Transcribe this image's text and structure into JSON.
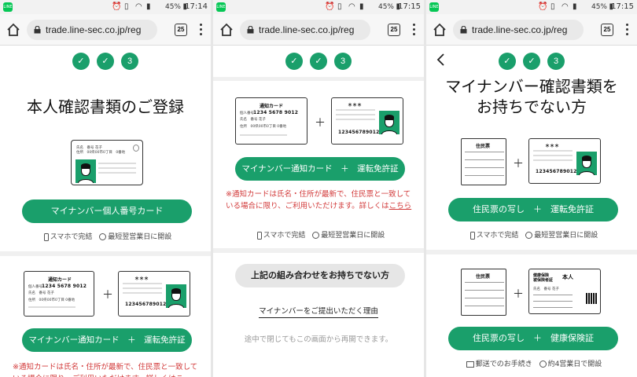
{
  "status": {
    "battery": "45%",
    "times": [
      "17:14",
      "17:15",
      "17:15"
    ],
    "icons": [
      "line-icon",
      "alarm-icon",
      "vibrate-icon",
      "wifi-icon",
      "signal-icon",
      "battery-icon"
    ]
  },
  "browser": {
    "url": "trade.line-sec.co.jp/reg",
    "tab_count": "25"
  },
  "steps": [
    "✓",
    "✓",
    "3"
  ],
  "p1": {
    "title": "本人確認書類のご登録",
    "card1_btn": "マイナンバー個人番号カード",
    "meta_phone": "スマホで完結",
    "meta_clock": "最短翌営業日に開設",
    "card2_btn": "マイナンバー通知カード　＋　運転免許証",
    "note": "※通知カードは氏名・住所が最新で、住民票と一致している場合に限り、ご利用いただけます。詳しくはこ"
  },
  "cards": {
    "mynumber_name": "氏名　番号 花子",
    "mynumber_addr": "住所　00県00市0丁目　0番地",
    "tsuchi_title": "通知カード",
    "tsuchi_num_label": "個人番号",
    "tsuchi_num": "1234 5678 9012",
    "tsuchi_name": "氏名　番号 花子",
    "tsuchi_addr": "住所　00県00市0丁目 0番地",
    "license_stars": "＊＊＊",
    "license_num": "123456789012",
    "juminhyo_title": "住民票",
    "insurance_title1": "健康保険",
    "insurance_title2": "被保険者証",
    "insurance_person": "本人",
    "insurance_name": "氏名　番号 花子"
  },
  "p2": {
    "btn1": "マイナンバー通知カード　＋　運転免許証",
    "note_pre": "※通知カードは氏名・住所が最新で、住民票と一致している場合に限り、ご利用いただけます。詳しくは",
    "note_link": "こちら",
    "meta_phone": "スマホで完結",
    "meta_clock": "最短翌営業日に開設",
    "none_btn": "上記の組み合わせをお持ちでない方",
    "reason_link": "マイナンバーをご提出いただく理由",
    "resume": "途中で閉じてもこの画面から再開できます。"
  },
  "p3": {
    "title_line1": "マイナンバー確認書類を",
    "title_line2": "お持ちでない方",
    "btn1": "住民票の写し　＋　運転免許証",
    "meta_phone": "スマホで完結",
    "meta_clock": "最短翌営業日に開設",
    "btn2": "住民票の写し　＋　健康保険証",
    "meta_mail": "郵送でのお手続き",
    "meta_clock2": "約4営業日で開設"
  },
  "plus": "＋",
  "colors": {
    "accent": "#1a9f6b",
    "warning": "#d23a3a"
  }
}
